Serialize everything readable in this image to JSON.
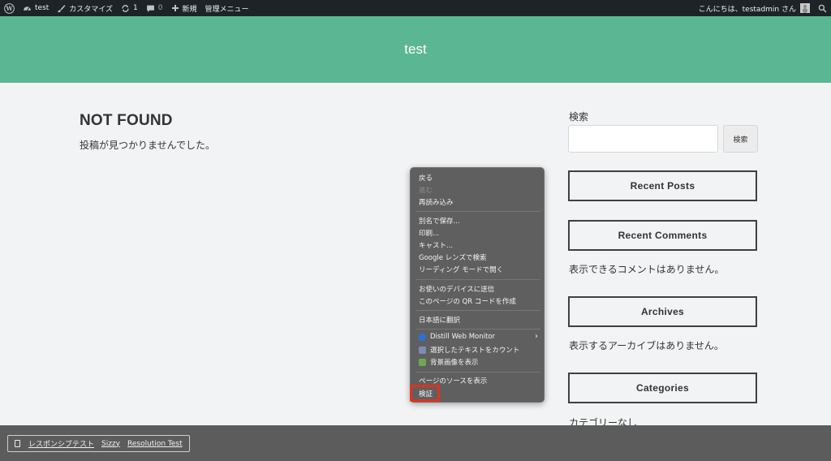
{
  "adminbar": {
    "site_name": "test",
    "customize": "カスタマイズ",
    "updates": "1",
    "comments": "0",
    "new": "新規",
    "admin_menu": "管理メニュー",
    "greeting": "こんにちは、testadmin さん"
  },
  "header": {
    "title": "test"
  },
  "main": {
    "title": "NOT FOUND",
    "message": "投稿が見つかりませんでした。"
  },
  "sidebar": {
    "search_label": "検索",
    "search_value": "",
    "search_button": "検索",
    "recent_posts": "Recent Posts",
    "recent_comments": "Recent Comments",
    "no_comments": "表示できるコメントはありません。",
    "archives": "Archives",
    "no_archives": "表示するアーカイブはありません。",
    "categories": "Categories",
    "no_categories": "カテゴリーなし"
  },
  "context_menu": {
    "back": "戻る",
    "forward": "進む",
    "reload": "再読み込み",
    "save_as": "別名で保存...",
    "print": "印刷...",
    "cast": "キャスト...",
    "google_lens": "Google レンズで検索",
    "reading_mode": "リーディング モードで開く",
    "send_to_devices": "お使いのデバイスに送信",
    "qr_code": "このページの QR コードを作成",
    "translate": "日本語に翻訳",
    "distill": "Distill Web Monitor",
    "count_text": "選択したテキストをカウント",
    "show_bg_image": "背景画像を表示",
    "view_source": "ページのソースを表示",
    "inspect": "検証"
  },
  "bottom_tools": {
    "responsive_test": "レスポンシブテスト",
    "sizzy": "Sizzy",
    "resolution_test": "Resolution Test"
  },
  "colors": {
    "header_bg": "#5bb793",
    "adminbar_bg": "#1d2327",
    "menu_bg": "#5f5f60",
    "highlight": "#e0321f",
    "bottom_bar_bg": "#5c5c5c"
  }
}
